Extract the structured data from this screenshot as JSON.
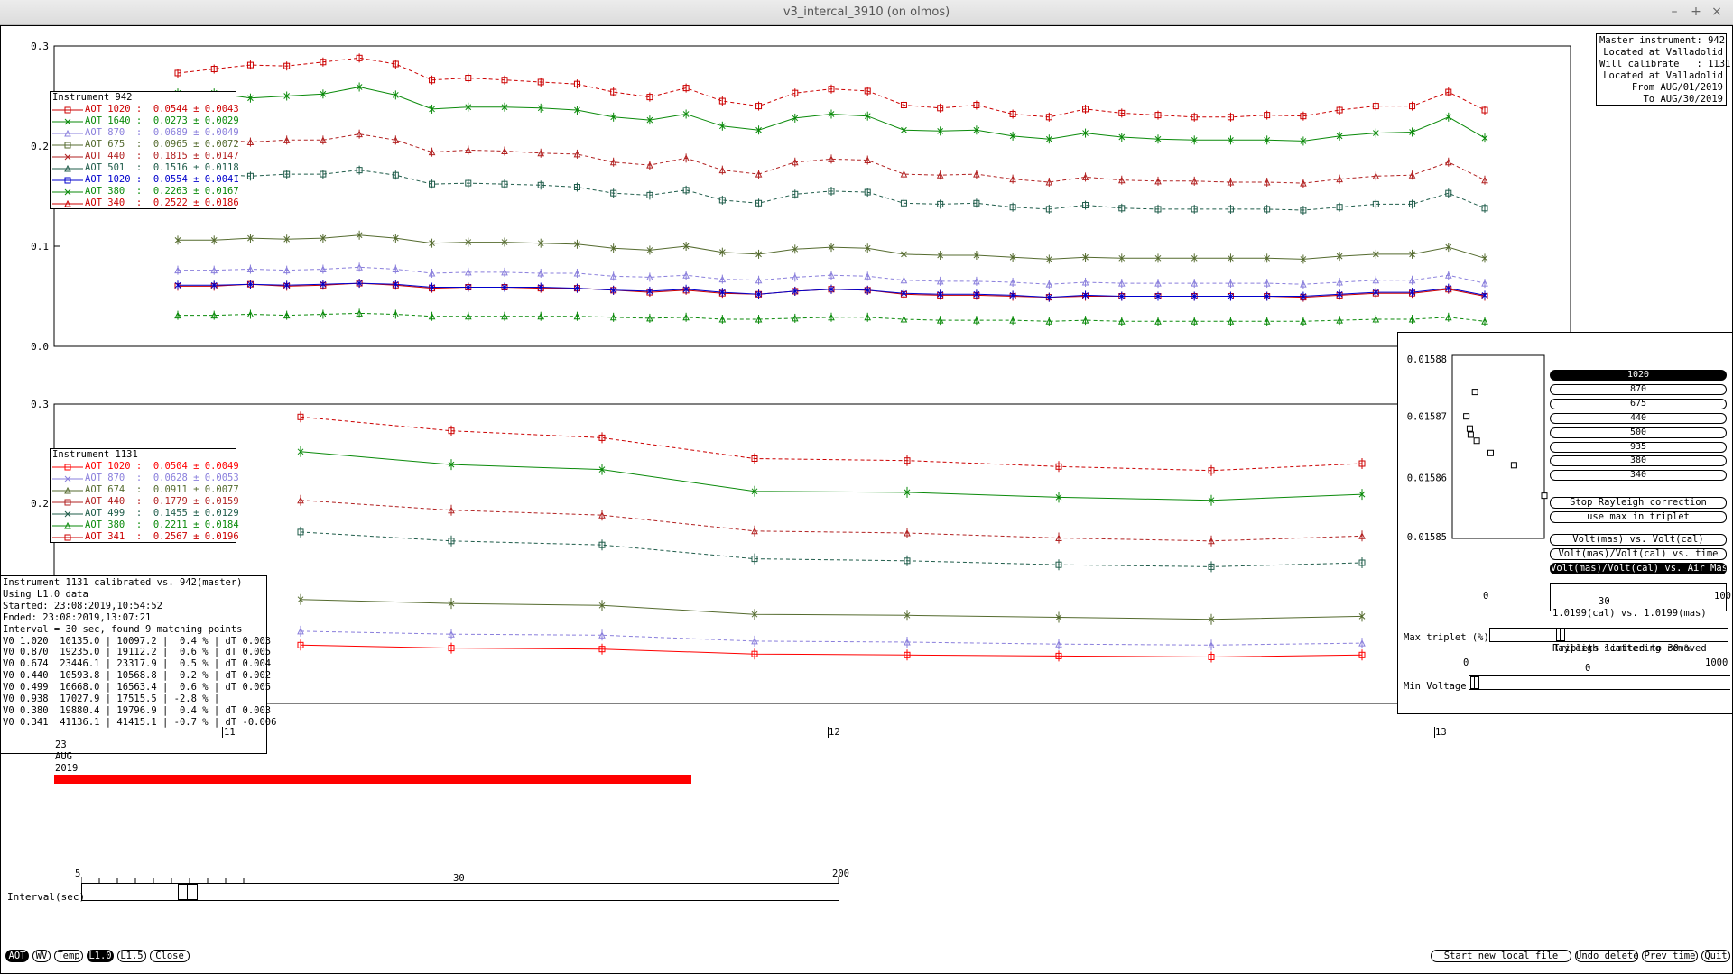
{
  "window": {
    "title": "v3_intercal_3910 (on olmos)",
    "minimize": "–",
    "maximize": "+",
    "close": "×"
  },
  "info_box": [
    "Master instrument: 942",
    "Located at Valladolid",
    "Will calibrate   : 1131",
    "Located at Valladolid",
    "From AUG/01/2019",
    "To AUG/30/2019"
  ],
  "colors": {
    "red": "#cc0000",
    "darkred": "#b22222",
    "green": "#0a8a0a",
    "lavender": "#8a7fdc",
    "olive": "#556b2f",
    "teal": "#1f5c4a",
    "bright_red": "#ff0000",
    "blue": "#0000cc"
  },
  "chart_data": [
    {
      "type": "line",
      "name": "top",
      "ylim": [
        0.0,
        0.3
      ],
      "yticks": [
        "0.3",
        "0.2",
        "0.1",
        "0.0"
      ],
      "x": [
        1,
        2,
        3,
        4,
        5,
        6,
        7,
        8,
        9,
        10,
        11,
        12,
        13,
        14,
        15,
        16,
        17,
        18,
        19,
        20,
        21,
        22,
        23,
        24,
        25,
        26,
        27,
        28,
        29,
        30,
        31,
        32,
        33,
        34,
        35,
        36,
        37
      ],
      "series": [
        {
          "name": "AOT 340",
          "color": "#cc0000",
          "dash": true,
          "values": [
            0.273,
            0.277,
            0.281,
            0.28,
            0.284,
            0.288,
            0.282,
            0.266,
            0.268,
            0.266,
            0.264,
            0.262,
            0.254,
            0.249,
            0.258,
            0.245,
            0.24,
            0.253,
            0.257,
            0.255,
            0.241,
            0.238,
            0.241,
            0.232,
            0.229,
            0.237,
            0.233,
            0.231,
            0.229,
            0.229,
            0.231,
            0.23,
            0.236,
            0.24,
            0.24,
            0.254,
            0.236
          ]
        },
        {
          "name": "AOT 380",
          "color": "#0a8a0a",
          "dash": false,
          "values": [
            0.253,
            0.253,
            0.248,
            0.25,
            0.252,
            0.259,
            0.251,
            0.237,
            0.239,
            0.239,
            0.238,
            0.236,
            0.229,
            0.226,
            0.232,
            0.22,
            0.216,
            0.228,
            0.232,
            0.23,
            0.216,
            0.215,
            0.216,
            0.21,
            0.207,
            0.213,
            0.209,
            0.207,
            0.206,
            0.206,
            0.206,
            0.205,
            0.21,
            0.213,
            0.214,
            0.229,
            0.208
          ]
        },
        {
          "name": "AOT 440",
          "color": "#b22222",
          "dash": true,
          "values": [
            0.208,
            0.207,
            0.204,
            0.206,
            0.206,
            0.212,
            0.206,
            0.194,
            0.196,
            0.195,
            0.193,
            0.192,
            0.184,
            0.181,
            0.188,
            0.176,
            0.172,
            0.184,
            0.187,
            0.186,
            0.172,
            0.171,
            0.172,
            0.167,
            0.164,
            0.169,
            0.166,
            0.165,
            0.165,
            0.164,
            0.164,
            0.163,
            0.167,
            0.17,
            0.171,
            0.184,
            0.166
          ]
        },
        {
          "name": "AOT 501",
          "color": "#1f5c4a",
          "dash": true,
          "values": [
            0.173,
            0.172,
            0.17,
            0.172,
            0.172,
            0.176,
            0.171,
            0.162,
            0.163,
            0.162,
            0.161,
            0.159,
            0.153,
            0.151,
            0.156,
            0.146,
            0.143,
            0.152,
            0.155,
            0.154,
            0.143,
            0.142,
            0.143,
            0.139,
            0.137,
            0.141,
            0.138,
            0.137,
            0.137,
            0.137,
            0.137,
            0.136,
            0.139,
            0.142,
            0.142,
            0.153,
            0.138
          ]
        },
        {
          "name": "AOT 675",
          "color": "#556b2f",
          "dash": false,
          "values": [
            0.106,
            0.106,
            0.108,
            0.107,
            0.108,
            0.111,
            0.108,
            0.103,
            0.104,
            0.104,
            0.103,
            0.102,
            0.098,
            0.096,
            0.1,
            0.094,
            0.092,
            0.097,
            0.099,
            0.098,
            0.092,
            0.091,
            0.091,
            0.089,
            0.087,
            0.089,
            0.088,
            0.088,
            0.088,
            0.088,
            0.088,
            0.087,
            0.09,
            0.092,
            0.092,
            0.099,
            0.088
          ]
        },
        {
          "name": "AOT 870",
          "color": "#8a7fdc",
          "dash": true,
          "values": [
            0.076,
            0.076,
            0.077,
            0.076,
            0.077,
            0.079,
            0.077,
            0.073,
            0.074,
            0.074,
            0.073,
            0.073,
            0.07,
            0.069,
            0.071,
            0.067,
            0.066,
            0.069,
            0.071,
            0.07,
            0.066,
            0.065,
            0.065,
            0.064,
            0.062,
            0.064,
            0.063,
            0.063,
            0.063,
            0.063,
            0.063,
            0.062,
            0.064,
            0.066,
            0.066,
            0.071,
            0.063
          ]
        },
        {
          "name": "AOT 1020",
          "color": "#cc0000",
          "dash": false,
          "values": [
            0.06,
            0.06,
            0.062,
            0.06,
            0.061,
            0.063,
            0.061,
            0.058,
            0.059,
            0.059,
            0.058,
            0.058,
            0.056,
            0.054,
            0.056,
            0.053,
            0.052,
            0.055,
            0.057,
            0.056,
            0.052,
            0.051,
            0.051,
            0.05,
            0.049,
            0.05,
            0.05,
            0.05,
            0.05,
            0.05,
            0.05,
            0.049,
            0.051,
            0.053,
            0.053,
            0.057,
            0.05
          ]
        },
        {
          "name": "AOT 1020",
          "color": "#0000cc",
          "dash": false,
          "values": [
            0.061,
            0.061,
            0.062,
            0.061,
            0.062,
            0.063,
            0.062,
            0.059,
            0.059,
            0.059,
            0.059,
            0.058,
            0.056,
            0.055,
            0.057,
            0.054,
            0.052,
            0.055,
            0.057,
            0.056,
            0.053,
            0.052,
            0.052,
            0.051,
            0.049,
            0.051,
            0.05,
            0.05,
            0.05,
            0.05,
            0.05,
            0.05,
            0.052,
            0.054,
            0.054,
            0.058,
            0.051
          ]
        },
        {
          "name": "AOT 1640",
          "color": "#0a8a0a",
          "dash": true,
          "values": [
            0.031,
            0.031,
            0.032,
            0.031,
            0.032,
            0.033,
            0.032,
            0.03,
            0.03,
            0.03,
            0.03,
            0.03,
            0.029,
            0.028,
            0.029,
            0.027,
            0.027,
            0.028,
            0.029,
            0.029,
            0.027,
            0.026,
            0.026,
            0.026,
            0.025,
            0.026,
            0.025,
            0.025,
            0.025,
            0.025,
            0.025,
            0.025,
            0.026,
            0.027,
            0.027,
            0.029,
            0.025
          ]
        }
      ]
    },
    {
      "type": "line",
      "name": "bottom",
      "ylim": [
        0.0,
        0.3
      ],
      "yticks": [
        "0.3",
        "0.2"
      ],
      "x": [
        1,
        2,
        3,
        4,
        5,
        6,
        7,
        8
      ],
      "series": [
        {
          "name": "AOT 341",
          "color": "#cc0000",
          "dash": true,
          "values": [
            0.287,
            0.273,
            0.266,
            0.245,
            0.243,
            0.237,
            0.233,
            0.24
          ]
        },
        {
          "name": "AOT 380",
          "color": "#0a8a0a",
          "dash": false,
          "values": [
            0.252,
            0.239,
            0.234,
            0.212,
            0.211,
            0.206,
            0.203,
            0.209
          ]
        },
        {
          "name": "AOT 440",
          "color": "#b22222",
          "dash": true,
          "values": [
            0.203,
            0.193,
            0.188,
            0.172,
            0.17,
            0.165,
            0.162,
            0.167
          ]
        },
        {
          "name": "AOT 499",
          "color": "#1f5c4a",
          "dash": true,
          "values": [
            0.171,
            0.162,
            0.158,
            0.144,
            0.142,
            0.138,
            0.136,
            0.14
          ]
        },
        {
          "name": "AOT 674",
          "color": "#556b2f",
          "dash": false,
          "values": [
            0.103,
            0.099,
            0.097,
            0.088,
            0.087,
            0.085,
            0.083,
            0.086
          ]
        },
        {
          "name": "AOT 870",
          "color": "#8a7fdc",
          "dash": true,
          "values": [
            0.071,
            0.068,
            0.067,
            0.061,
            0.06,
            0.058,
            0.057,
            0.059
          ]
        },
        {
          "name": "AOT 1020",
          "color": "#ff0000",
          "dash": false,
          "values": [
            0.057,
            0.054,
            0.053,
            0.048,
            0.047,
            0.046,
            0.045,
            0.047
          ]
        }
      ]
    },
    {
      "type": "scatter",
      "name": "triplet",
      "ylim": [
        0.01585,
        0.01588
      ],
      "yticks": [
        "0.01588",
        "0.01587",
        "0.01586",
        "0.01585"
      ],
      "xtick": "1.15",
      "points": [
        [
          0.1,
          0.01587
        ],
        [
          0.14,
          0.015868
        ],
        [
          0.15,
          0.015867
        ],
        [
          0.2,
          0.015874
        ],
        [
          0.22,
          0.015866
        ],
        [
          0.38,
          0.015864
        ],
        [
          0.65,
          0.015862
        ],
        [
          1.0,
          0.015857
        ]
      ]
    }
  ],
  "legend_top": {
    "title": "Instrument 942",
    "items": [
      {
        "label": "AOT 1020 :",
        "value": "0.0544 ± 0.0043",
        "color": "#cc0000"
      },
      {
        "label": "AOT 1640 :",
        "value": "0.0273 ± 0.0029",
        "color": "#0a8a0a"
      },
      {
        "label": "AOT 870  :",
        "value": "0.0689 ± 0.0049",
        "color": "#8a7fdc"
      },
      {
        "label": "AOT 675  :",
        "value": "0.0965 ± 0.0072",
        "color": "#556b2f"
      },
      {
        "label": "AOT 440  :",
        "value": "0.1815 ± 0.0147",
        "color": "#b22222"
      },
      {
        "label": "AOT 501  :",
        "value": "0.1516 ± 0.0118",
        "color": "#1f5c4a"
      },
      {
        "label": "AOT 1020 :",
        "value": "0.0554 ± 0.0041",
        "color": "#0000cc"
      },
      {
        "label": "AOT 380  :",
        "value": "0.2263 ± 0.0167",
        "color": "#0a8a0a"
      },
      {
        "label": "AOT 340  :",
        "value": "0.2522 ± 0.0186",
        "color": "#cc0000"
      }
    ]
  },
  "legend_bottom": {
    "title": "Instrument 1131",
    "items": [
      {
        "label": "AOT 1020 :",
        "value": "0.0504 ± 0.0049",
        "color": "#ff0000"
      },
      {
        "label": "AOT 870  :",
        "value": "0.0628 ± 0.0053",
        "color": "#8a7fdc"
      },
      {
        "label": "AOT 674  :",
        "value": "0.0911 ± 0.0077",
        "color": "#556b2f"
      },
      {
        "label": "AOT 440  :",
        "value": "0.1779 ± 0.0159",
        "color": "#b22222"
      },
      {
        "label": "AOT 499  :",
        "value": "0.1455 ± 0.0129",
        "color": "#1f5c4a"
      },
      {
        "label": "AOT 380  :",
        "value": "0.2211 ± 0.0184",
        "color": "#0a8a0a"
      },
      {
        "label": "AOT 341  :",
        "value": "0.2567 ± 0.0196",
        "color": "#cc0000"
      }
    ]
  },
  "calib_text": [
    "Instrument 1131 calibrated vs. 942(master)",
    "Using L1.0 data",
    "Started: 23:08:2019,10:54:52",
    "Ended: 23:08:2019,13:07:21",
    "Interval = 30 sec, found 9 matching points",
    "V0 1.020  10135.0 | 10097.2 |  0.4 % | dT 0.003",
    "V0 0.870  19235.0 | 19112.2 |  0.6 % | dT 0.005",
    "V0 0.674  23446.1 | 23317.9 |  0.5 % | dT 0.004",
    "V0 0.440  10593.8 | 10568.8 |  0.2 % | dT 0.002",
    "V0 0.499  16668.0 | 16563.4 |  0.6 % | dT 0.005",
    "V0 0.938  17027.9 | 17515.5 | -2.8 % |",
    "V0 0.380  19880.4 | 19796.9 |  0.4 % | dT 0.003",
    "V0 0.341  41136.1 | 41415.1 | -0.7 % | dT -0.006"
  ],
  "time_axis": {
    "ticks": [
      "11",
      "12",
      "13"
    ],
    "day": "23",
    "month": "AUG",
    "year": "2019",
    "coverage": 0.66
  },
  "wavelength_buttons": [
    "1020",
    "870",
    "675",
    "440",
    "500",
    "935",
    "380",
    "340"
  ],
  "option_buttons": [
    "Stop Rayleigh correction",
    "use max in triplet"
  ],
  "plot_mode_buttons": [
    "Volt(mas) vs. Volt(cal)",
    "Volt(mas)/Volt(cal) vs. time",
    "Volt(mas)/Volt(cal) vs. Air Mass"
  ],
  "ratio_text": [
    "1.0199(cal) vs. 1.0199(mas)",
    "Rayleigh scattering removed"
  ],
  "max_triplet": {
    "label": "Max triplet (%)",
    "min": "0",
    "mid": "30",
    "max": "100",
    "note": "Triplets limited to 30 %",
    "value": 30
  },
  "min_voltage": {
    "label": "Min Voltage",
    "min": "0",
    "mid": "0",
    "max": "1000",
    "value": 0
  },
  "interval": {
    "label": "Interval(sec)",
    "min": "5",
    "mid": "30",
    "max": "200",
    "value": 30
  },
  "bottom_left_buttons": [
    {
      "label": "AOT",
      "selected": true
    },
    {
      "label": "WV",
      "selected": false
    },
    {
      "label": "Temp",
      "selected": false
    },
    {
      "label": "L1.0",
      "selected": true
    },
    {
      "label": "L1.5",
      "selected": false
    },
    {
      "label": "Close",
      "selected": false
    }
  ],
  "bottom_right_buttons": [
    "Start new local file",
    "Undo delete",
    "Prev time",
    "Quit"
  ]
}
